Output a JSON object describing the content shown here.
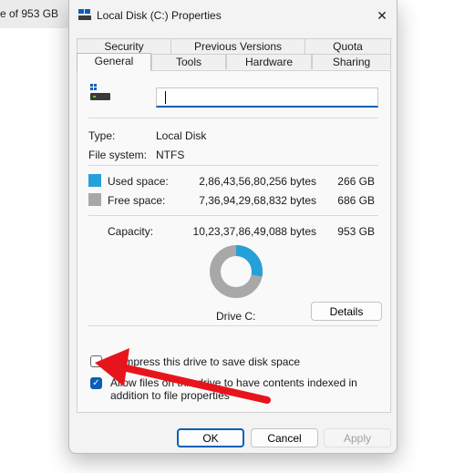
{
  "background": {
    "window_fragment_text": "e of 953 GB"
  },
  "dialog": {
    "title": "Local Disk (C:) Properties",
    "close_symbol": "✕"
  },
  "tabs": {
    "row1": [
      "Security",
      "Previous Versions",
      "Quota"
    ],
    "row2": [
      "General",
      "Tools",
      "Hardware",
      "Sharing"
    ],
    "active": "General"
  },
  "general": {
    "volume_label_value": "",
    "type_label": "Type:",
    "type_value": "Local Disk",
    "fs_label": "File system:",
    "fs_value": "NTFS",
    "used_label": "Used space:",
    "used_bytes": "2,86,43,56,80,256 bytes",
    "used_gb": "266 GB",
    "free_label": "Free space:",
    "free_bytes": "7,36,94,29,68,832 bytes",
    "free_gb": "686 GB",
    "capacity_label": "Capacity:",
    "capacity_bytes": "10,23,37,86,49,088 bytes",
    "capacity_gb": "953 GB",
    "drive_label": "Drive C:",
    "details_button": "Details",
    "used_fraction": 0.28,
    "compress_label": "Compress this drive to save disk space",
    "compress_checked": false,
    "index_label": "Allow files on this drive to have contents indexed in addition to file properties",
    "index_checked": true
  },
  "buttons": {
    "ok": "OK",
    "cancel": "Cancel",
    "apply": "Apply"
  },
  "colors": {
    "used": "#26a0da",
    "free": "#a8a8a8",
    "accent": "#0a5fb4",
    "arrow": "#e8141c"
  },
  "icons": {
    "title": "drive-icon",
    "drive": "drive-icon",
    "close": "close-icon",
    "arrow": "red-arrow-annotation"
  }
}
